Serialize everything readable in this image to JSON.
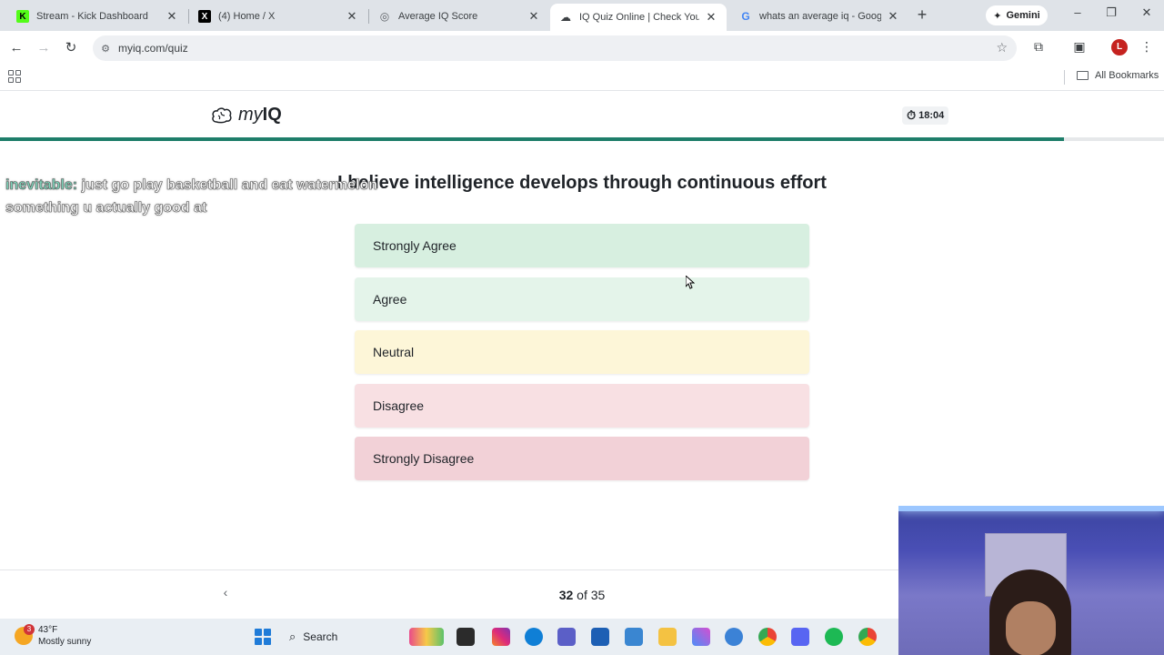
{
  "browser": {
    "tabs": [
      {
        "title": "Stream - Kick Dashboard",
        "favicon": "kick-icon"
      },
      {
        "title": "(4) Home / X",
        "favicon": "x-icon"
      },
      {
        "title": "Average IQ Score",
        "favicon": "globe-icon"
      },
      {
        "title": "IQ Quiz Online | Check Your IQ",
        "favicon": "myiq-icon",
        "active": true
      },
      {
        "title": "whats an average iq - Google S",
        "favicon": "google-icon"
      }
    ],
    "gemini_label": "Gemini",
    "url": "myiq.com/quiz",
    "all_bookmarks": "All Bookmarks",
    "profile_initial": "L"
  },
  "site": {
    "logo_my": "my",
    "logo_iq": "IQ",
    "timer": "18:04",
    "progress_fraction": 0.914
  },
  "quiz": {
    "question": "I believe intelligence develops through continuous effort",
    "answers": [
      "Strongly Agree",
      "Agree",
      "Neutral",
      "Disagree",
      "Strongly Disagree"
    ],
    "current": "32",
    "of_label": "of",
    "total": "35"
  },
  "chat": {
    "user": "inevitable:",
    "message": "just go play basketball and eat watermelon something u actually good at"
  },
  "taskbar": {
    "temperature": "43°F",
    "condition": "Mostly sunny",
    "weather_badge": "3",
    "search_label": "Search"
  },
  "colors": {
    "progress": "#1e7e6a",
    "strongly_agree": "#d7efe0",
    "agree": "#e4f4ea",
    "neutral": "#fdf6d8",
    "disagree": "#f8e0e3",
    "strongly_disagree": "#f2d1d7"
  }
}
